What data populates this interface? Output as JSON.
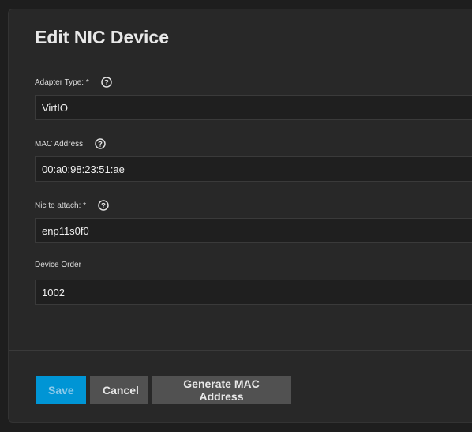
{
  "dialog": {
    "title": "Edit NIC Device"
  },
  "fields": {
    "adapter_type": {
      "label": "Adapter Type: *",
      "value": "VirtIO",
      "help_icon": "help-circle-icon"
    },
    "mac_address": {
      "label": "MAC Address",
      "value": "00:a0:98:23:51:ae",
      "help_icon": "help-circle-icon"
    },
    "nic_attach": {
      "label": "Nic to attach: *",
      "value": "enp11s0f0",
      "help_icon": "help-circle-icon"
    },
    "device_order": {
      "label": "Device Order",
      "value": "1002"
    }
  },
  "actions": {
    "save_label": "Save",
    "cancel_label": "Cancel",
    "generate_mac_label": "Generate MAC Address"
  },
  "colors": {
    "background": "#1e1e1e",
    "panel": "#282828",
    "primary": "#0095d5",
    "secondary_button": "#515151"
  }
}
